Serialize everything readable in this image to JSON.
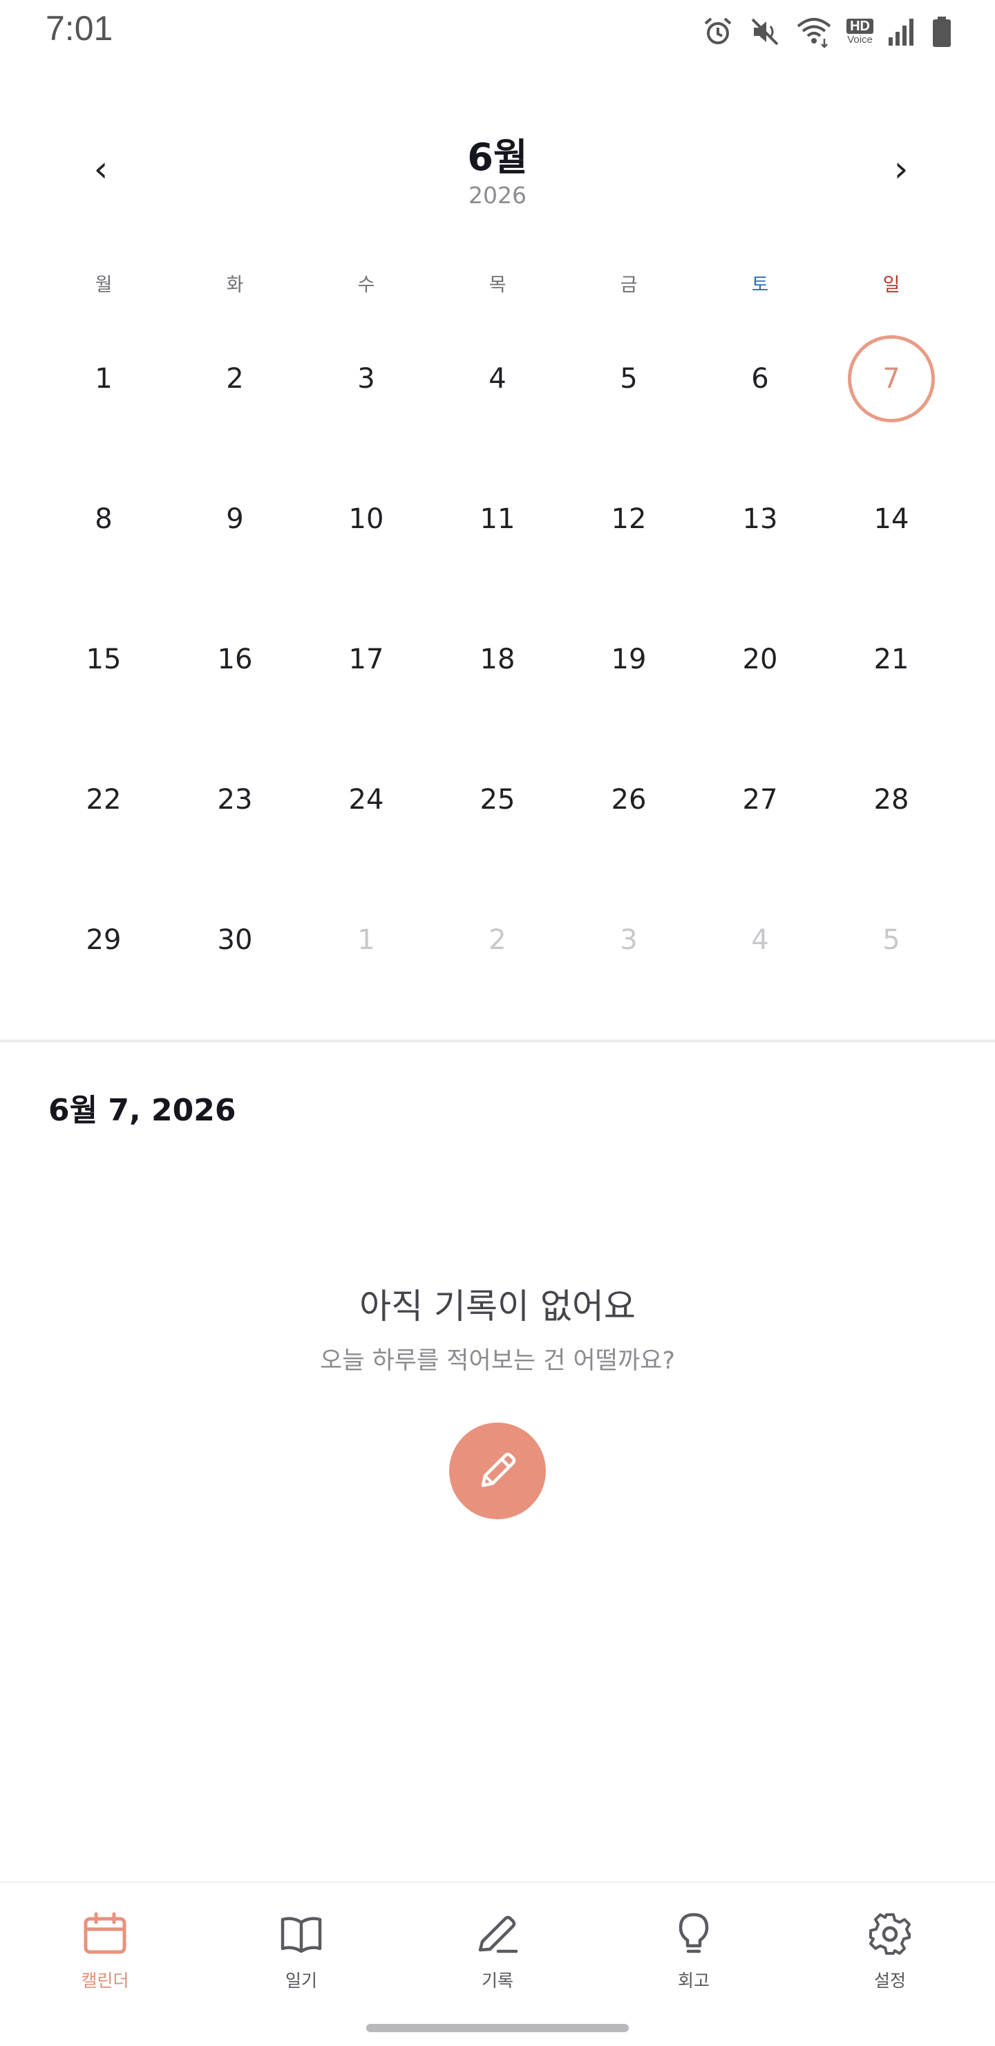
{
  "status_bar": {
    "time": "7:01",
    "icons": [
      "alarm-icon",
      "mute-icon",
      "wifi-icon",
      "hd-voice-icon",
      "signal-icon",
      "battery-icon"
    ],
    "hd_text": "HD",
    "voice_text": "Voice"
  },
  "header": {
    "month": "6월",
    "year": "2026",
    "prev": "‹",
    "next": "›"
  },
  "weekdays": [
    "월",
    "화",
    "수",
    "목",
    "금",
    "토",
    "일"
  ],
  "weeks": [
    [
      "1",
      "2",
      "3",
      "4",
      "5",
      "6",
      "7"
    ],
    [
      "8",
      "9",
      "10",
      "11",
      "12",
      "13",
      "14"
    ],
    [
      "15",
      "16",
      "17",
      "18",
      "19",
      "20",
      "21"
    ],
    [
      "22",
      "23",
      "24",
      "25",
      "26",
      "27",
      "28"
    ],
    [
      "29",
      "30",
      "1",
      "2",
      "3",
      "4",
      "5"
    ]
  ],
  "selected_date": "6월 7, 2026",
  "empty_state": {
    "title": "아직 기록이 없어요",
    "subtitle": "오늘 하루를 적어보는 건 어떨까요?"
  },
  "nav": {
    "items": [
      {
        "label": "캘린더",
        "icon": "calendar-icon"
      },
      {
        "label": "일기",
        "icon": "book-icon"
      },
      {
        "label": "기록",
        "icon": "pen-icon"
      },
      {
        "label": "회고",
        "icon": "lightbulb-icon"
      },
      {
        "label": "설정",
        "icon": "gear-icon"
      }
    ]
  },
  "colors": {
    "accent": "#e8927e",
    "saturday": "#2f6db1",
    "sunday": "#c0322b"
  }
}
